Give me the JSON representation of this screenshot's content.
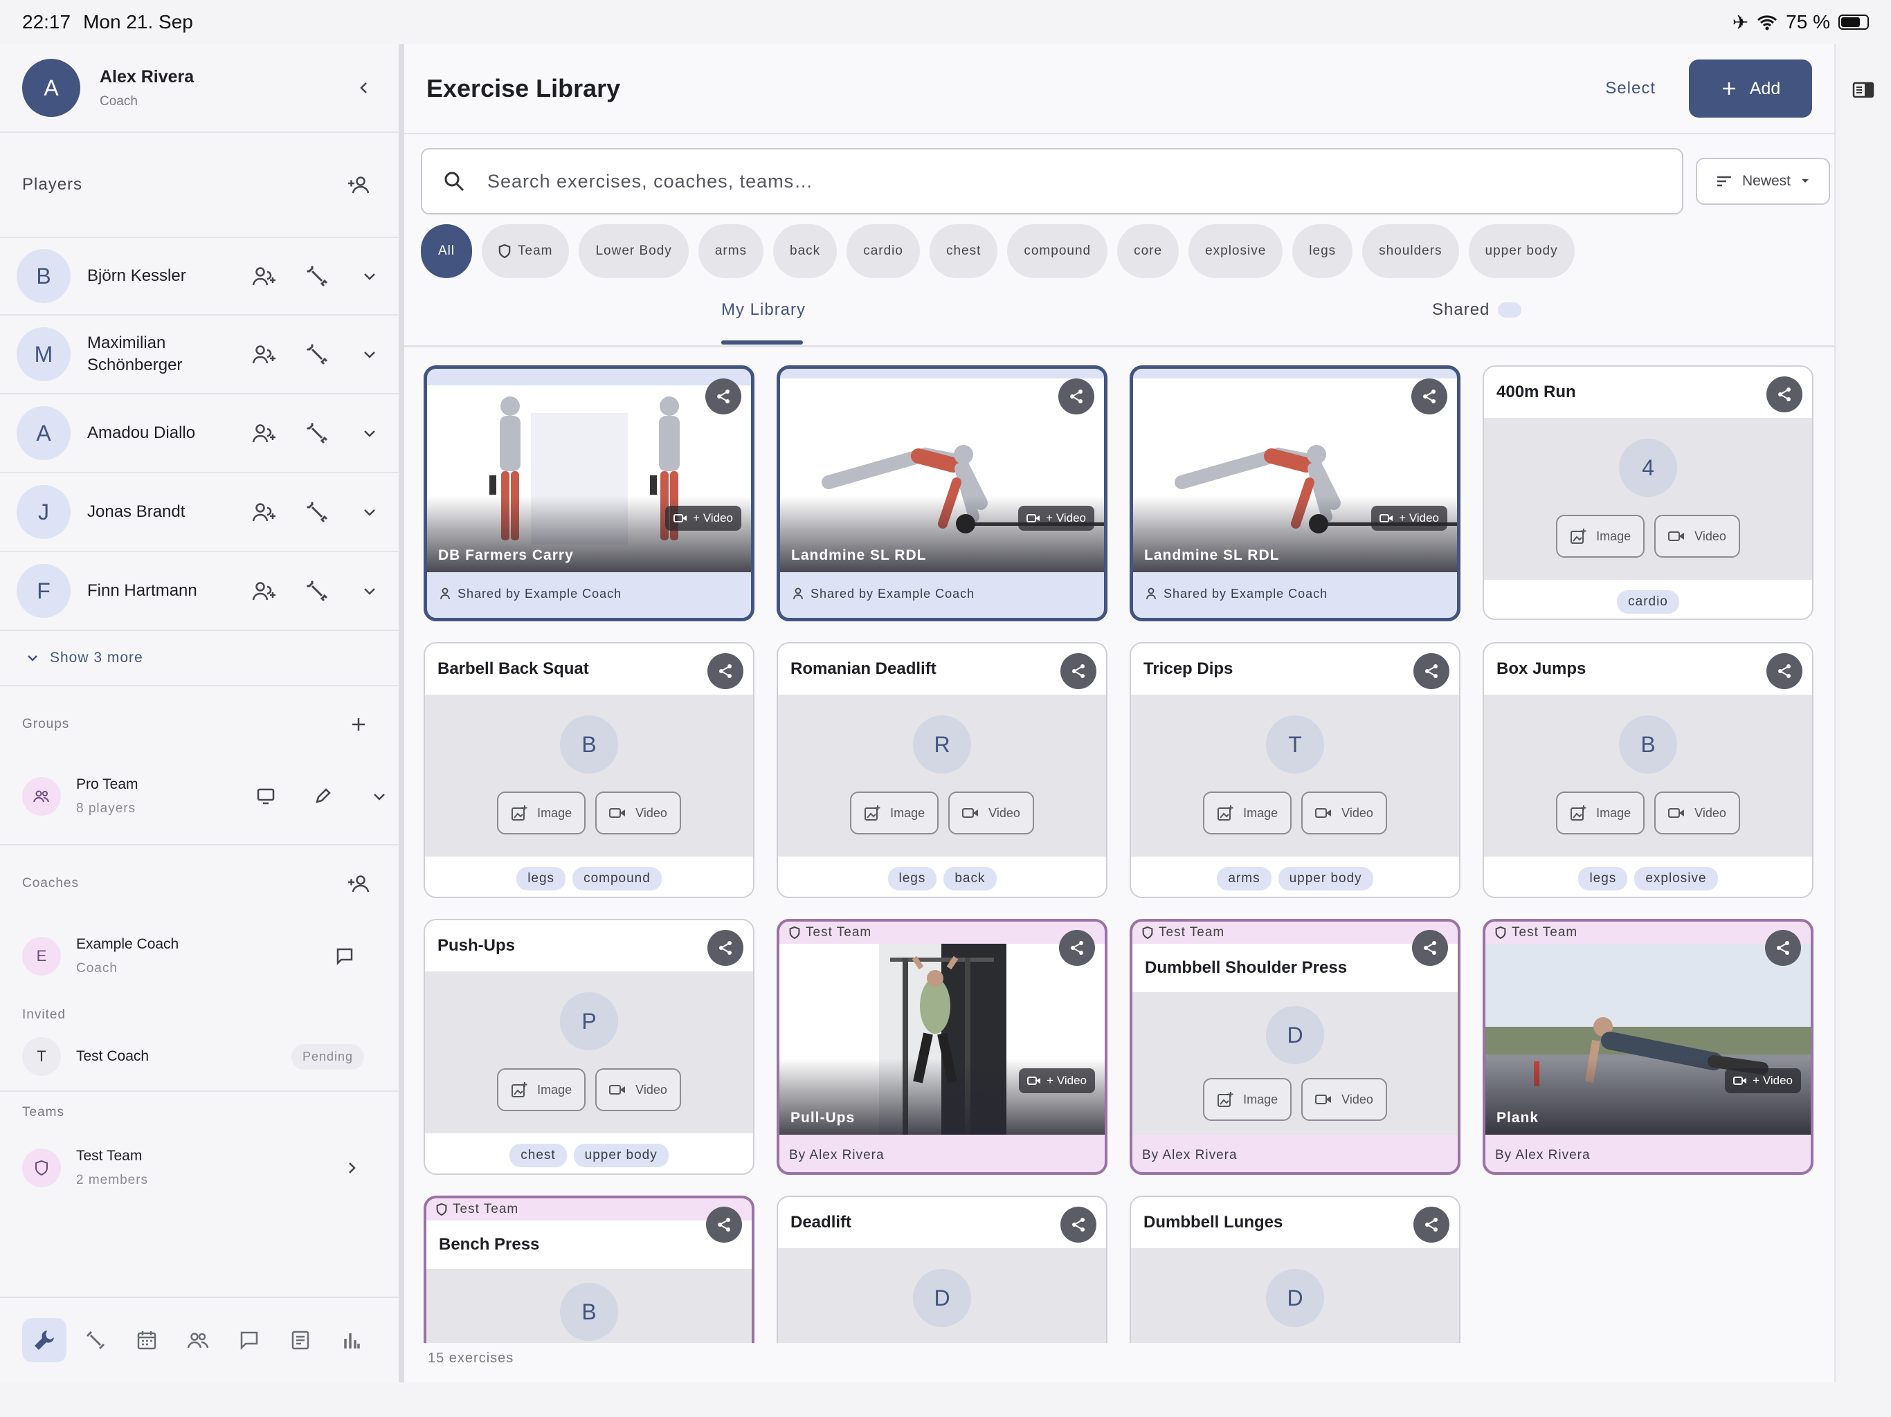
{
  "status": {
    "time": "22:17",
    "date": "Mon 21. Sep",
    "battery": "75 %",
    "battery_level": 0.75
  },
  "profile": {
    "initial": "A",
    "name": "Alex Rivera",
    "role": "Coach"
  },
  "players": {
    "title": "Players",
    "items": [
      {
        "initial": "B",
        "name": "Björn Kessler"
      },
      {
        "initial": "M",
        "name": "Maximilian Schönberger"
      },
      {
        "initial": "A",
        "name": "Amadou Diallo"
      },
      {
        "initial": "J",
        "name": "Jonas Brandt"
      },
      {
        "initial": "F",
        "name": "Finn Hartmann"
      }
    ],
    "show_more": "Show 3 more"
  },
  "groups": {
    "title": "Groups",
    "items": [
      {
        "name": "Pro Team",
        "count": "8 players"
      }
    ]
  },
  "coaches": {
    "title": "Coaches",
    "items": [
      {
        "initial": "E",
        "name": "Example Coach",
        "role": "Coach"
      }
    ],
    "invited_label": "Invited",
    "invited": [
      {
        "initial": "T",
        "name": "Test Coach",
        "status": "Pending"
      }
    ]
  },
  "teams": {
    "title": "Teams",
    "items": [
      {
        "name": "Test Team",
        "count": "2 members"
      }
    ]
  },
  "header": {
    "title": "Exercise Library",
    "select": "Select",
    "add": "Add"
  },
  "search": {
    "placeholder": "Search exercises, coaches, teams…",
    "sort": "Newest"
  },
  "filters": [
    "All",
    "Team",
    "Lower Body",
    "arms",
    "back",
    "cardio",
    "chest",
    "compound",
    "core",
    "explosive",
    "legs",
    "shoulders",
    "upper body"
  ],
  "tabs": {
    "my_library": "My Library",
    "shared": "Shared"
  },
  "common": {
    "image": "Image",
    "video": "Video",
    "add_video": "+ Video",
    "team_label": "Test Team"
  },
  "shared_cards": [
    {
      "title": "DB Farmers Carry",
      "shared_by": "Shared by Example Coach"
    },
    {
      "title": "Landmine SL RDL",
      "shared_by": "Shared by Example Coach"
    },
    {
      "title": "Landmine SL RDL",
      "shared_by": "Shared by Example Coach"
    }
  ],
  "placeholder_cards": [
    {
      "title": "400m Run",
      "letter": "4",
      "tags": [
        "cardio"
      ]
    },
    {
      "title": "Barbell Back Squat",
      "letter": "B",
      "tags": [
        "legs",
        "compound"
      ]
    },
    {
      "title": "Romanian Deadlift",
      "letter": "R",
      "tags": [
        "legs",
        "back"
      ]
    },
    {
      "title": "Tricep Dips",
      "letter": "T",
      "tags": [
        "arms",
        "upper body"
      ]
    },
    {
      "title": "Box Jumps",
      "letter": "B",
      "tags": [
        "legs",
        "explosive"
      ]
    },
    {
      "title": "Push-Ups",
      "letter": "P",
      "tags": [
        "chest",
        "upper body"
      ]
    },
    {
      "title": "Deadlift",
      "letter": "D",
      "tags": []
    },
    {
      "title": "Dumbbell Lunges",
      "letter": "D",
      "tags": []
    }
  ],
  "team_cards": [
    {
      "title": "Pull-Ups",
      "by": "By Alex Rivera"
    },
    {
      "title": "Dumbbell Shoulder Press",
      "letter": "D",
      "by": "By Alex Rivera"
    },
    {
      "title": "Plank",
      "by": "By Alex Rivera"
    },
    {
      "title": "Bench Press",
      "letter": "B"
    }
  ],
  "footer": {
    "count": "15 exercises"
  }
}
